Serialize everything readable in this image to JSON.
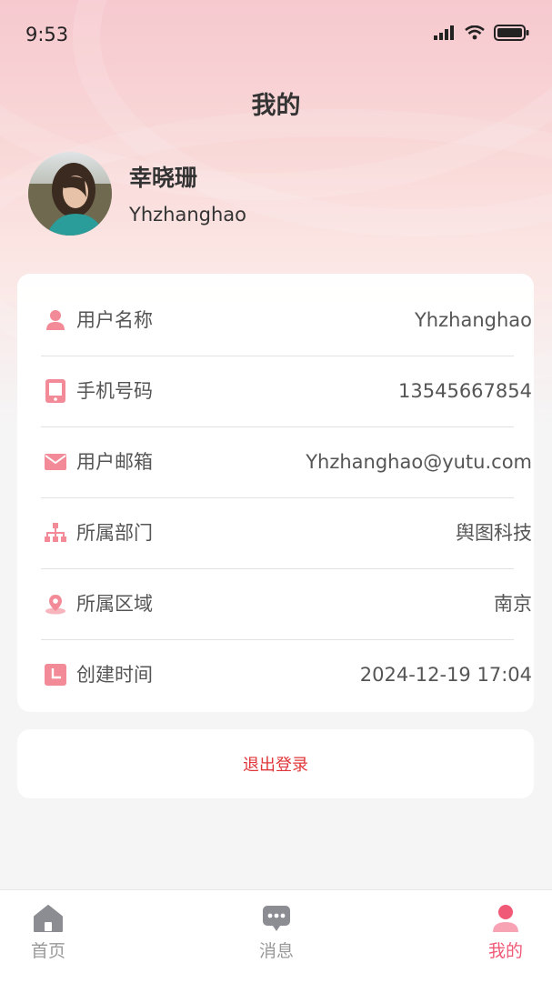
{
  "status_bar": {
    "time": "9:53"
  },
  "header": {
    "title": "我的"
  },
  "profile": {
    "name": "幸晓珊",
    "account": "Yhzhanghao"
  },
  "info": {
    "rows": [
      {
        "icon": "user-icon",
        "label": "用户名称",
        "value": "Yhzhanghao"
      },
      {
        "icon": "phone-icon",
        "label": "手机号码",
        "value": "13545667854"
      },
      {
        "icon": "mail-icon",
        "label": "用户邮箱",
        "value": "Yhzhanghao@yutu.com"
      },
      {
        "icon": "org-chart-icon",
        "label": "所属部门",
        "value": "舆图科技"
      },
      {
        "icon": "location-icon",
        "label": "所属区域",
        "value": "南京"
      },
      {
        "icon": "clock-icon",
        "label": "创建时间",
        "value": "2024-12-19 17:04"
      }
    ]
  },
  "logout": {
    "label": "退出登录"
  },
  "tab_bar": {
    "tabs": [
      {
        "icon": "home-icon",
        "label": "首页",
        "active": false
      },
      {
        "icon": "chat-icon",
        "label": "消息",
        "active": false
      },
      {
        "icon": "profile-icon",
        "label": "我的",
        "active": true
      }
    ]
  },
  "colors": {
    "accent": "#f05a77",
    "icon_pink": "#f28b97",
    "logout_red": "#e0373a"
  }
}
